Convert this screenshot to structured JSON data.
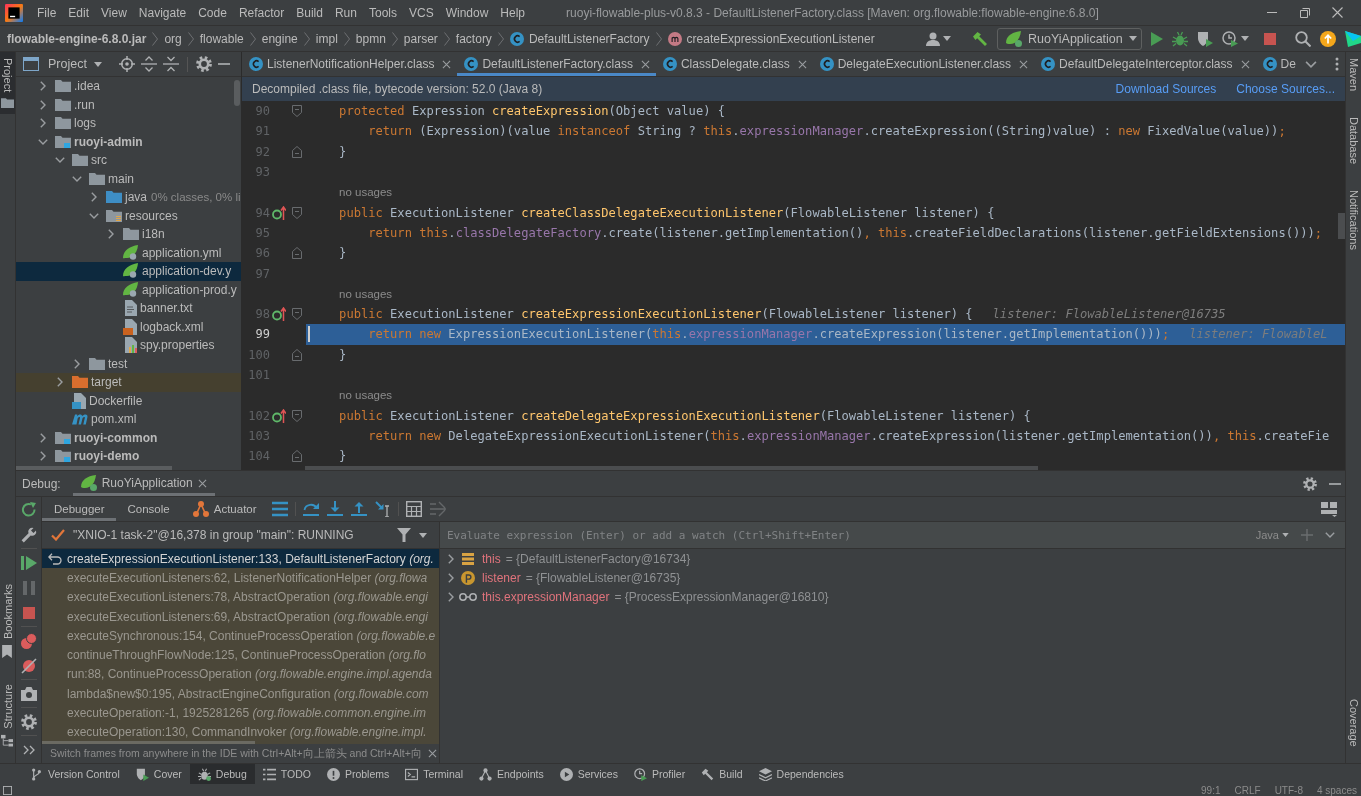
{
  "menu": {
    "items": [
      "File",
      "Edit",
      "View",
      "Navigate",
      "Code",
      "Refactor",
      "Build",
      "Run",
      "Tools",
      "VCS",
      "Window",
      "Help"
    ],
    "title": "ruoyi-flowable-plus-v0.8.3 - DefaultListenerFactory.class [Maven: org.flowable:flowable-engine:6.8.0]"
  },
  "breadcrumbs": [
    {
      "label": "flowable-engine-6.8.0.jar",
      "kind": "jar"
    },
    {
      "label": "org",
      "kind": "package"
    },
    {
      "label": "flowable",
      "kind": "package"
    },
    {
      "label": "engine",
      "kind": "package"
    },
    {
      "label": "impl",
      "kind": "package"
    },
    {
      "label": "bpmn",
      "kind": "package"
    },
    {
      "label": "parser",
      "kind": "package"
    },
    {
      "label": "factory",
      "kind": "package"
    },
    {
      "label": "DefaultListenerFactory",
      "kind": "class"
    },
    {
      "label": "createExpressionExecutionListener",
      "kind": "method"
    }
  ],
  "run_config": "RuoYiApplication",
  "left_strip": {
    "top": [
      {
        "label": "Project",
        "selected": true
      }
    ],
    "bottom": [
      {
        "label": "Bookmarks",
        "selected": false
      },
      {
        "label": "Structure",
        "selected": false
      }
    ]
  },
  "right_strip": {
    "top": [
      {
        "label": "Maven",
        "selected": false
      },
      {
        "label": "Database",
        "selected": false
      },
      {
        "label": "Notifications",
        "selected": false
      }
    ],
    "bottom": [
      {
        "label": "Coverage",
        "selected": false
      }
    ]
  },
  "project_panel": {
    "title": "Project",
    "tree": [
      {
        "label": ".idea",
        "kind": "folder",
        "expanded": false,
        "selected": false
      },
      {
        "label": ".run",
        "kind": "folder",
        "expanded": false,
        "selected": false
      },
      {
        "label": "logs",
        "kind": "folder",
        "expanded": false,
        "selected": false
      },
      {
        "label": "ruoyi-admin",
        "kind": "module",
        "expanded": true,
        "selected": false,
        "children": [
          {
            "label": "src",
            "kind": "folder",
            "expanded": true,
            "selected": false,
            "children": [
              {
                "label": "main",
                "kind": "folder",
                "expanded": true,
                "selected": false,
                "children": [
                  {
                    "label": "java",
                    "kind": "source-folder",
                    "expanded": false,
                    "selected": false,
                    "note": "0% classes, 0% li"
                  },
                  {
                    "label": "resources",
                    "kind": "resource-folder",
                    "expanded": true,
                    "selected": false,
                    "children": [
                      {
                        "label": "i18n",
                        "kind": "folder",
                        "expanded": false,
                        "selected": false
                      },
                      {
                        "label": "application.yml",
                        "kind": "spring-config",
                        "selected": false
                      },
                      {
                        "label": "application-dev.y",
                        "kind": "spring-config",
                        "selected": true
                      },
                      {
                        "label": "application-prod.y",
                        "kind": "spring-config",
                        "selected": false
                      },
                      {
                        "label": "banner.txt",
                        "kind": "text-file",
                        "selected": false
                      },
                      {
                        "label": "logback.xml",
                        "kind": "xml-file",
                        "selected": false
                      },
                      {
                        "label": "spy.properties",
                        "kind": "properties-file",
                        "selected": false
                      }
                    ]
                  }
                ]
              },
              {
                "label": "test",
                "kind": "folder",
                "expanded": false,
                "selected": false
              }
            ]
          },
          {
            "label": "target",
            "kind": "excluded-folder",
            "expanded": false,
            "selected": false
          },
          {
            "label": "Dockerfile",
            "kind": "docker-file",
            "selected": false
          },
          {
            "label": "pom.xml",
            "kind": "maven-file",
            "selected": false
          }
        ]
      },
      {
        "label": "ruoyi-common",
        "kind": "module",
        "expanded": false,
        "selected": false
      },
      {
        "label": "ruoyi-demo",
        "kind": "module",
        "expanded": false,
        "selected": false
      }
    ]
  },
  "editor": {
    "tabs": [
      {
        "label": "ListenerNotificationHelper.class",
        "selected": false
      },
      {
        "label": "DefaultListenerFactory.class",
        "selected": true
      },
      {
        "label": "ClassDelegate.class",
        "selected": false
      },
      {
        "label": "DelegateExecutionListener.class",
        "selected": false
      },
      {
        "label": "DefaultDelegateInterceptor.class",
        "selected": false
      },
      {
        "label": "De",
        "selected": false
      }
    ],
    "banner": {
      "text": "Decompiled .class file, bytecode version: 52.0 (Java 8)",
      "links": [
        "Download Sources",
        "Choose Sources..."
      ]
    },
    "lines": [
      {
        "number": "90",
        "kind": "opener",
        "implements": false,
        "current": false,
        "tokens": [
          {
            "text": "    protected",
            "kind": "keyword"
          },
          {
            "text": " Expression ",
            "kind": "plain"
          },
          {
            "text": "createExpression",
            "kind": "declaration"
          },
          {
            "text": "(Object value) {",
            "kind": "plain"
          }
        ]
      },
      {
        "number": "91",
        "kind": "statement",
        "implements": false,
        "current": false,
        "tokens": [
          {
            "text": "        return",
            "kind": "keyword"
          },
          {
            "text": " (Expression)(value ",
            "kind": "plain"
          },
          {
            "text": "instanceof",
            "kind": "keyword"
          },
          {
            "text": " String ? ",
            "kind": "plain"
          },
          {
            "text": "this",
            "kind": "keyword"
          },
          {
            "text": ".",
            "kind": "plain"
          },
          {
            "text": "expressionManager",
            "kind": "field"
          },
          {
            "text": ".createExpression((String)value) : ",
            "kind": "plain"
          },
          {
            "text": "new",
            "kind": "keyword"
          },
          {
            "text": " FixedValue(value))",
            "kind": "plain"
          },
          {
            "text": ";",
            "kind": "keyword"
          }
        ]
      },
      {
        "number": "92",
        "kind": "closer",
        "implements": false,
        "current": false,
        "tokens": [
          {
            "text": "    }",
            "kind": "plain"
          }
        ]
      },
      {
        "number": "93",
        "kind": "blank",
        "implements": false,
        "current": false
      },
      {
        "number": "94",
        "kind": "opener",
        "inlay": "no usages",
        "implements": true,
        "current": false,
        "tokens": [
          {
            "text": "    public",
            "kind": "keyword"
          },
          {
            "text": " ExecutionListener ",
            "kind": "plain"
          },
          {
            "text": "createClassDelegateExecutionListener",
            "kind": "declaration"
          },
          {
            "text": "(FlowableListener listener) {",
            "kind": "plain"
          }
        ]
      },
      {
        "number": "95",
        "kind": "statement",
        "implements": false,
        "current": false,
        "tokens": [
          {
            "text": "        return",
            "kind": "keyword"
          },
          {
            "text": " this",
            "kind": "keyword"
          },
          {
            "text": ".",
            "kind": "plain"
          },
          {
            "text": "classDelegateFactory",
            "kind": "field"
          },
          {
            "text": ".create(listener.getImplementation()",
            "kind": "plain"
          },
          {
            "text": ",",
            "kind": "keyword"
          },
          {
            "text": " this",
            "kind": "keyword"
          },
          {
            "text": ".createFieldDeclarations(listener.getFieldExtensions()))",
            "kind": "plain"
          },
          {
            "text": ";",
            "kind": "keyword"
          }
        ]
      },
      {
        "number": "96",
        "kind": "closer",
        "implements": false,
        "current": false,
        "tokens": [
          {
            "text": "    }",
            "kind": "plain"
          }
        ]
      },
      {
        "number": "97",
        "kind": "blank",
        "implements": false,
        "current": false
      },
      {
        "number": "98",
        "kind": "opener",
        "inlay": "no usages",
        "implements": true,
        "current": false,
        "hint": "listener: FlowableListener@16735",
        "tokens": [
          {
            "text": "    public",
            "kind": "keyword"
          },
          {
            "text": " ExecutionListener ",
            "kind": "plain"
          },
          {
            "text": "createExpressionExecutionListener",
            "kind": "declaration"
          },
          {
            "text": "(FlowableListener listener) {",
            "kind": "plain"
          }
        ]
      },
      {
        "number": "99",
        "kind": "statement",
        "implements": false,
        "current": true,
        "hint": "listener: FlowableL",
        "tokens": [
          {
            "text": "        return",
            "kind": "keyword"
          },
          {
            "text": " new",
            "kind": "keyword"
          },
          {
            "text": " ExpressionExecutionListener(",
            "kind": "plain"
          },
          {
            "text": "this",
            "kind": "keyword"
          },
          {
            "text": ".",
            "kind": "plain"
          },
          {
            "text": "expressionManager",
            "kind": "field"
          },
          {
            "text": ".createExpression(listener.getImplementation()))",
            "kind": "plain"
          },
          {
            "text": ";",
            "kind": "keyword"
          }
        ]
      },
      {
        "number": "100",
        "kind": "closer",
        "implements": false,
        "current": false,
        "tokens": [
          {
            "text": "    }",
            "kind": "plain"
          }
        ]
      },
      {
        "number": "101",
        "kind": "blank",
        "implements": false,
        "current": false
      },
      {
        "number": "102",
        "kind": "opener",
        "inlay": "no usages",
        "implements": true,
        "current": false,
        "tokens": [
          {
            "text": "    public",
            "kind": "keyword"
          },
          {
            "text": " ExecutionListener ",
            "kind": "plain"
          },
          {
            "text": "createDelegateExpressionExecutionListener",
            "kind": "declaration"
          },
          {
            "text": "(FlowableListener listener) {",
            "kind": "plain"
          }
        ]
      },
      {
        "number": "103",
        "kind": "statement",
        "implements": false,
        "current": false,
        "tokens": [
          {
            "text": "        return",
            "kind": "keyword"
          },
          {
            "text": " new",
            "kind": "keyword"
          },
          {
            "text": " DelegateExpressionExecutionListener(",
            "kind": "plain"
          },
          {
            "text": "this",
            "kind": "keyword"
          },
          {
            "text": ".",
            "kind": "plain"
          },
          {
            "text": "expressionManager",
            "kind": "field"
          },
          {
            "text": ".createExpression(listener.getImplementation())",
            "kind": "plain"
          },
          {
            "text": ",",
            "kind": "keyword"
          },
          {
            "text": " this",
            "kind": "keyword"
          },
          {
            "text": ".createFie",
            "kind": "plain"
          }
        ]
      },
      {
        "number": "104",
        "kind": "closer",
        "implements": false,
        "current": false,
        "tokens": [
          {
            "text": "    }",
            "kind": "plain"
          }
        ]
      }
    ]
  },
  "debug": {
    "title": "Debug:",
    "session": {
      "label": "RuoYiApplication",
      "selected": true
    },
    "side_toolbar": [
      {
        "kind": "rerun",
        "disabled": false
      },
      {
        "kind": "wrench",
        "disabled": false
      },
      {
        "kind": "resume",
        "disabled": false
      },
      {
        "kind": "pause",
        "disabled": true
      },
      {
        "kind": "stop",
        "disabled": false
      },
      {
        "kind": "breakpoints",
        "disabled": false
      },
      {
        "kind": "mute",
        "disabled": false
      },
      {
        "kind": "camera",
        "disabled": false
      },
      {
        "kind": "settings",
        "disabled": false
      },
      {
        "kind": "more",
        "disabled": false
      }
    ],
    "tabs": [
      {
        "label": "Debugger",
        "kind": "debugger",
        "selected": true
      },
      {
        "label": "Console",
        "kind": "console",
        "selected": false
      },
      {
        "label": "Actuator",
        "kind": "actuator",
        "selected": false
      }
    ],
    "toolbar": [
      {
        "kind": "frames-list",
        "disabled": false
      },
      {
        "kind": "step-over",
        "disabled": false
      },
      {
        "kind": "step-into",
        "disabled": false
      },
      {
        "kind": "step-out",
        "disabled": false
      },
      {
        "kind": "run-to-cursor",
        "disabled": false
      },
      {
        "kind": "evaluate",
        "disabled": false
      },
      {
        "kind": "trace",
        "disabled": true
      }
    ],
    "thread": "\"XNIO-1 task-2\"@16,378 in group \"main\": RUNNING",
    "frames": [
      {
        "text": "createExpressionExecutionListener:133, DefaultListenerFactory *(org.*",
        "selected": true
      },
      {
        "text": "executeExecutionListeners:62, ListenerNotificationHelper *(org.flowa*",
        "selected": false
      },
      {
        "text": "executeExecutionListeners:78, AbstractOperation *(org.flowable.engi*",
        "selected": false
      },
      {
        "text": "executeExecutionListeners:69, AbstractOperation *(org.flowable.engi*",
        "selected": false
      },
      {
        "text": "executeSynchronous:154, ContinueProcessOperation *(org.flowable.e*",
        "selected": false
      },
      {
        "text": "continueThroughFlowNode:125, ContinueProcessOperation *(org.flo*",
        "selected": false
      },
      {
        "text": "run:88, ContinueProcessOperation *(org.flowable.engine.impl.agenda*",
        "selected": false
      },
      {
        "text": "lambda$new$0:195, AbstractEngineConfiguration *(org.flowable.com*",
        "selected": false
      },
      {
        "text": "executeOperation:-1, 1925281265 *(org.flowable.common.engine.im*",
        "selected": false
      },
      {
        "text": "executeOperation:130, CommandInvoker *(org.flowable.engine.impl.*",
        "selected": false
      }
    ],
    "frames_tip": "Switch frames from anywhere in the IDE with Ctrl+Alt+向上箭头 and Ctrl+Alt+向",
    "evaluate": {
      "placeholder": "Evaluate expression (Enter) or add a watch (Ctrl+Shift+Enter)",
      "language": "Java",
      "add_disabled": true
    },
    "variables": [
      {
        "kind": "field",
        "name": "this",
        "value": "= {DefaultListenerFactory@16734}",
        "expanded": false
      },
      {
        "kind": "parameter",
        "name": "listener",
        "value": "= {FlowableListener@16735}",
        "expanded": false
      },
      {
        "kind": "watch",
        "name": "this.expressionManager",
        "value": "= {ProcessExpressionManager@16810}",
        "expanded": false
      }
    ]
  },
  "bottom_tools": [
    {
      "label": "Version Control",
      "selected": false
    },
    {
      "label": "Cover",
      "selected": false
    },
    {
      "label": "Debug",
      "selected": true
    },
    {
      "label": "TODO",
      "selected": false
    },
    {
      "label": "Problems",
      "selected": false
    },
    {
      "label": "Terminal",
      "selected": false
    },
    {
      "label": "Endpoints",
      "selected": false
    },
    {
      "label": "Services",
      "selected": false
    },
    {
      "label": "Profiler",
      "selected": false
    },
    {
      "label": "Build",
      "selected": false
    },
    {
      "label": "Dependencies",
      "selected": false
    }
  ],
  "status_bar": [
    "99:1",
    "CRLF",
    "UTF-8",
    "4 spaces"
  ]
}
